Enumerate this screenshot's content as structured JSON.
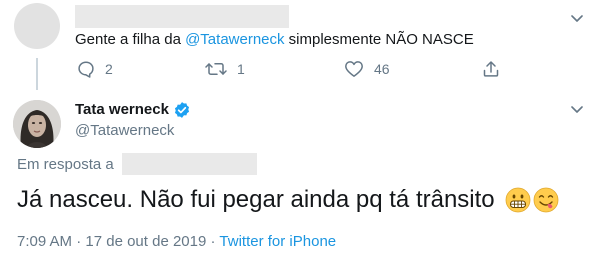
{
  "parent_tweet": {
    "text_prefix": "Gente a filha da ",
    "mention": "@Tatawerneck",
    "text_suffix": " simplesmente NÃO NASCE",
    "actions": {
      "reply_count": "2",
      "retweet_count": "1",
      "like_count": "46"
    }
  },
  "main_tweet": {
    "display_name": "Tata werneck",
    "handle": "@Tatawerneck",
    "reply_label": "Em resposta a",
    "text": "Já nasceu. Não fui pegar ainda pq tá trânsito",
    "emojis": [
      "grimacing-face-emoji",
      "face-savoring-food-emoji"
    ],
    "time": "7:09 AM",
    "date": "17 de out de 2019",
    "separator": " · ",
    "source": "Twitter for iPhone"
  },
  "colors": {
    "link": "#1b95e0",
    "secondary_text": "#657786",
    "verified": "#1da1f2",
    "like_icon": "#657786"
  }
}
